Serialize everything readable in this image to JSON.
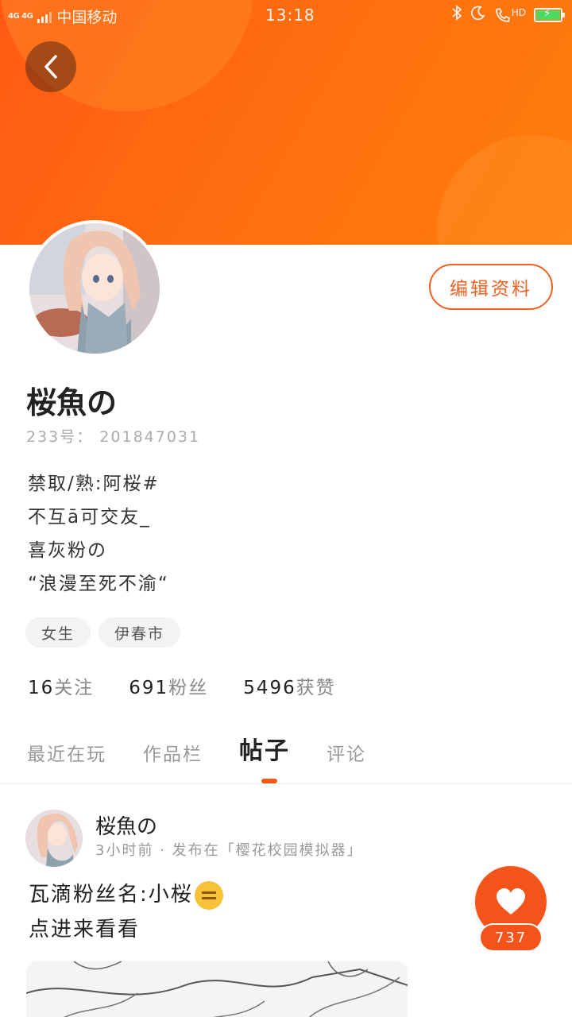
{
  "status_bar": {
    "network": "4G 4G",
    "carrier": "中国移动",
    "time": "13:18",
    "hd": "HD"
  },
  "profile": {
    "edit_label": "编辑资料",
    "username": "桜魚の",
    "uid": "233号： 201847031",
    "bio": [
      "禁取/熟:阿桜#",
      "不互ā可交友_",
      "喜灰粉の",
      "“浪漫至死不渝“"
    ],
    "tags": [
      "女生",
      "伊春市"
    ],
    "stats": [
      {
        "num": "16",
        "label": "关注"
      },
      {
        "num": "691",
        "label": "粉丝"
      },
      {
        "num": "5496",
        "label": "获赞"
      }
    ]
  },
  "tabs": [
    "最近在玩",
    "作品栏",
    "帖子",
    "评论"
  ],
  "active_tab": "帖子",
  "post": {
    "author": "桜魚の",
    "meta": "3小时前 · 发布在「樱花校园模拟器」",
    "text_line1": "瓦滴粉丝名:小桜",
    "text_line2": "点进来看看",
    "likes": "737"
  },
  "colors": {
    "accent": "#f4541a",
    "banner_start": "#ff5a14",
    "banner_end": "#ff7e0c"
  }
}
